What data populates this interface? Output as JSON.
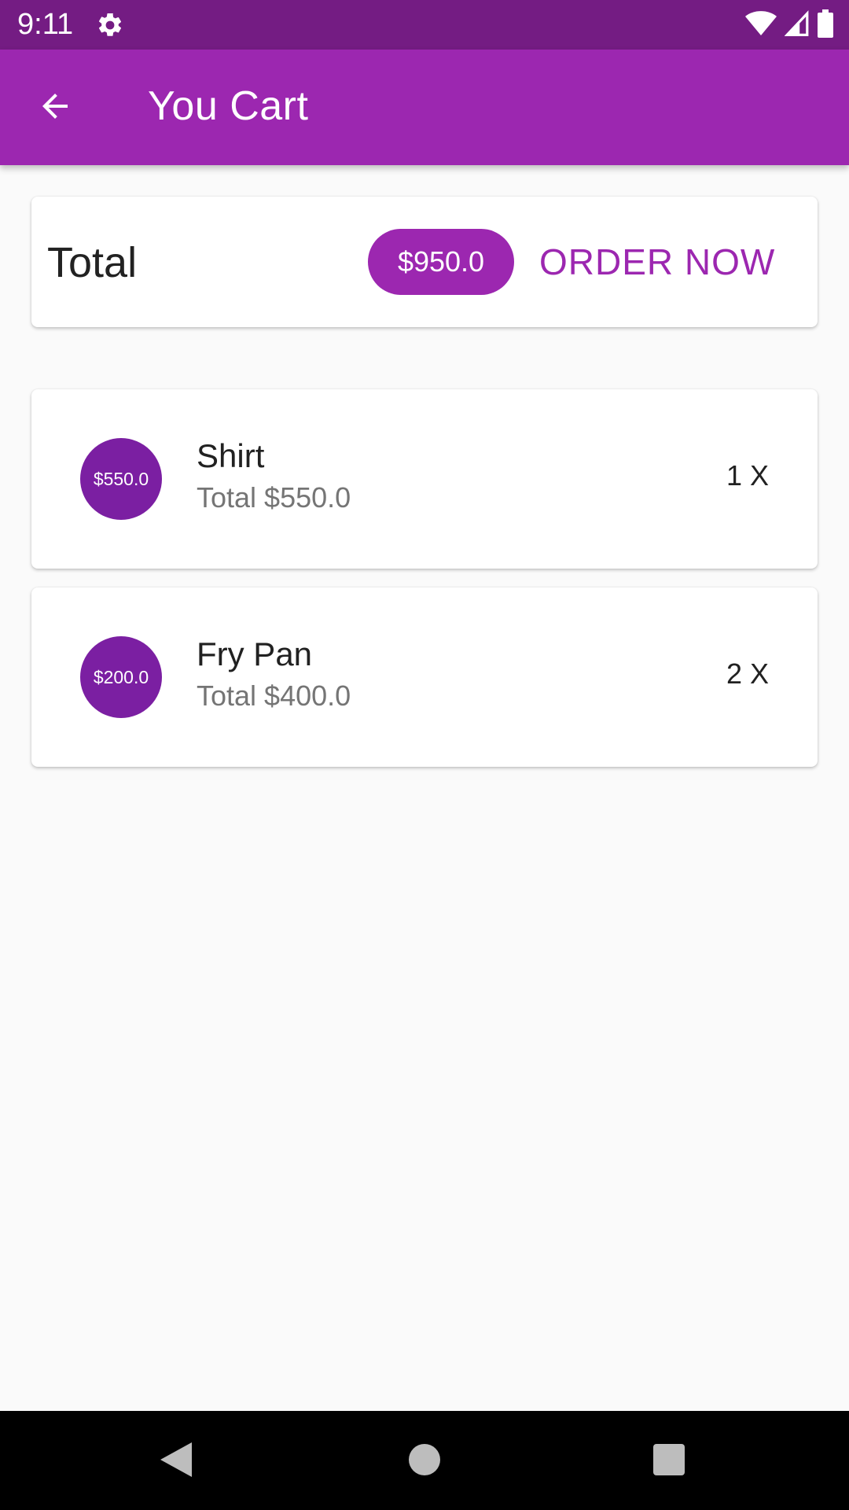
{
  "status_bar": {
    "time": "9:11",
    "icons": [
      "gear-icon",
      "wifi-icon",
      "cellular-icon",
      "battery-icon"
    ],
    "color": "#741c83"
  },
  "app_bar": {
    "title": "You Cart",
    "back_icon": "arrow-left-icon",
    "color": "#9c27b0"
  },
  "summary": {
    "label": "Total",
    "amount": "$950.0",
    "order_button": "ORDER NOW"
  },
  "cart_items": [
    {
      "avatar_price": "$550.0",
      "title": "Shirt",
      "subtitle": "Total $550.0",
      "quantity": "1 X"
    },
    {
      "avatar_price": "$200.0",
      "title": "Fry Pan",
      "subtitle": "Total $400.0",
      "quantity": "2 X"
    }
  ],
  "nav_bar": {
    "icons": [
      "back-triangle-icon",
      "home-circle-icon",
      "recents-square-icon"
    ]
  }
}
